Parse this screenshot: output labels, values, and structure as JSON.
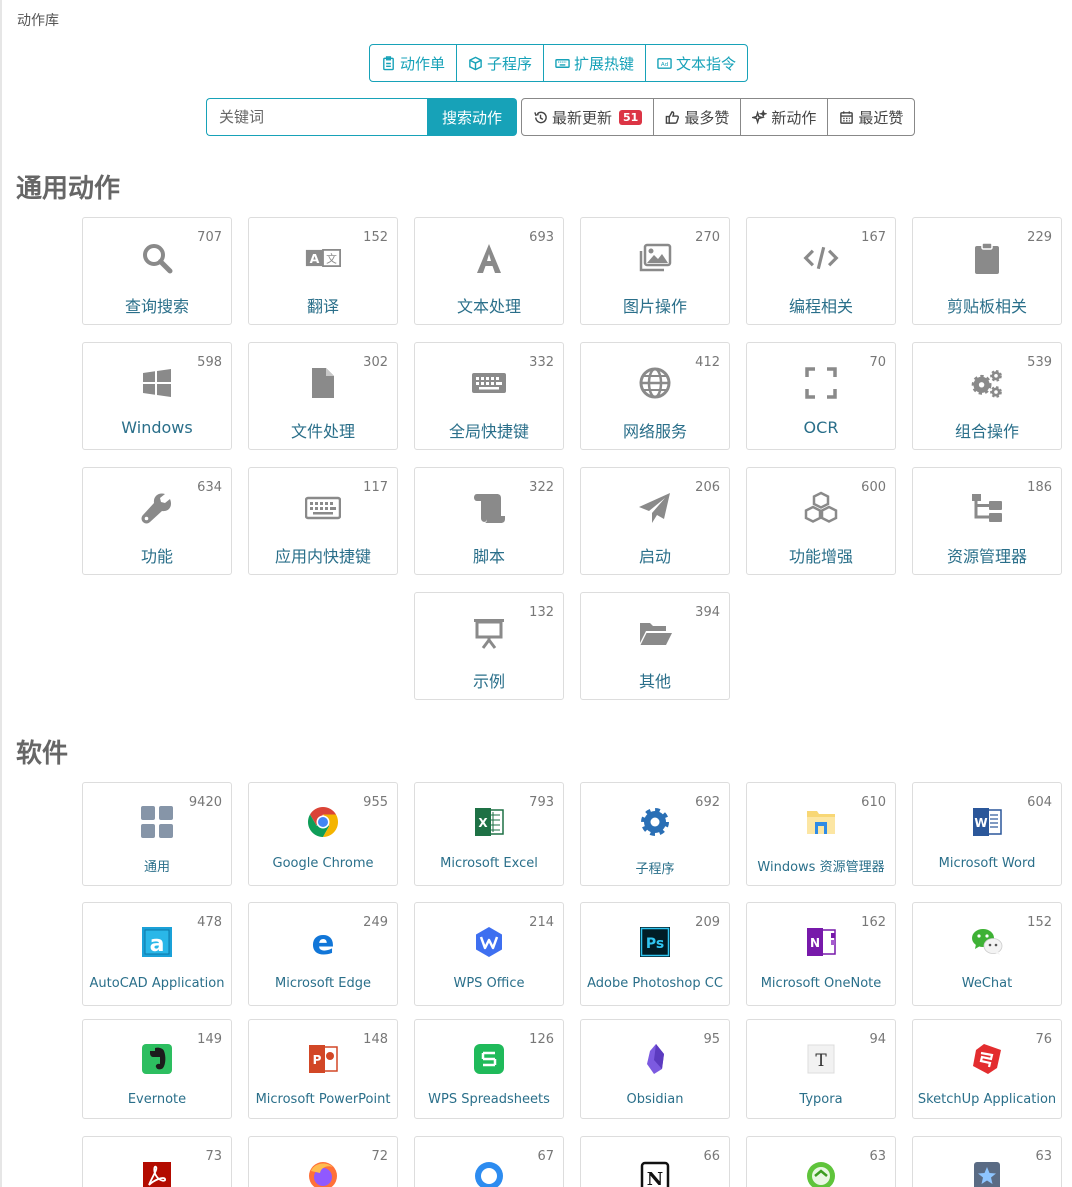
{
  "breadcrumb": "动作库",
  "type_tabs": [
    {
      "label": "动作单",
      "icon": "clipboard-icon"
    },
    {
      "label": "子程序",
      "icon": "cube-icon"
    },
    {
      "label": "扩展热键",
      "icon": "keyboard-icon"
    },
    {
      "label": "文本指令",
      "icon": "ad-icon"
    }
  ],
  "search": {
    "placeholder": "关键词",
    "button": "搜索动作"
  },
  "sort_tabs": [
    {
      "label": "最新更新",
      "icon": "history-icon",
      "badge": "51"
    },
    {
      "label": "最多赞",
      "icon": "thumbs-up-icon"
    },
    {
      "label": "新动作",
      "icon": "sparkle-icon"
    },
    {
      "label": "最近赞",
      "icon": "calendar-icon"
    }
  ],
  "colors": {
    "accent": "#17a2b8",
    "icon_gray": "#8a8a8a",
    "label_blue": "#2a6f8a",
    "badge_red": "#dc3545"
  },
  "sections": {
    "general": {
      "title": "通用动作",
      "cards": [
        {
          "label": "查询搜索",
          "count": "707",
          "icon": "search-icon"
        },
        {
          "label": "翻译",
          "count": "152",
          "icon": "translate-icon"
        },
        {
          "label": "文本处理",
          "count": "693",
          "icon": "font-a-icon"
        },
        {
          "label": "图片操作",
          "count": "270",
          "icon": "images-icon"
        },
        {
          "label": "编程相关",
          "count": "167",
          "icon": "code-icon"
        },
        {
          "label": "剪贴板相关",
          "count": "229",
          "icon": "clipboard-icon"
        },
        {
          "label": "Windows",
          "count": "598",
          "icon": "windows-icon"
        },
        {
          "label": "文件处理",
          "count": "302",
          "icon": "file-icon"
        },
        {
          "label": "全局快捷键",
          "count": "332",
          "icon": "keyboard-icon"
        },
        {
          "label": "网络服务",
          "count": "412",
          "icon": "globe-icon"
        },
        {
          "label": "OCR",
          "count": "70",
          "icon": "expand-icon"
        },
        {
          "label": "组合操作",
          "count": "539",
          "icon": "cogs-icon"
        },
        {
          "label": "功能",
          "count": "634",
          "icon": "wrench-icon"
        },
        {
          "label": "应用内快捷键",
          "count": "117",
          "icon": "keyboard-icon"
        },
        {
          "label": "脚本",
          "count": "322",
          "icon": "scroll-icon"
        },
        {
          "label": "启动",
          "count": "206",
          "icon": "paper-plane-icon"
        },
        {
          "label": "功能增强",
          "count": "600",
          "icon": "cubes-icon"
        },
        {
          "label": "资源管理器",
          "count": "186",
          "icon": "sitemap-icon"
        },
        {
          "label": "示例",
          "count": "132",
          "icon": "presentation-icon"
        },
        {
          "label": "其他",
          "count": "394",
          "icon": "folder-open-icon"
        }
      ]
    },
    "software": {
      "title": "软件",
      "cards": [
        {
          "label": "通用",
          "count": "9420",
          "icon": "grid-icon"
        },
        {
          "label": "Google Chrome",
          "count": "955",
          "icon": "chrome-icon"
        },
        {
          "label": "Microsoft Excel",
          "count": "793",
          "icon": "excel-icon"
        },
        {
          "label": "子程序",
          "count": "692",
          "icon": "gear-icon"
        },
        {
          "label": "Windows 资源管理器",
          "count": "610",
          "icon": "explorer-icon"
        },
        {
          "label": "Microsoft Word",
          "count": "604",
          "icon": "word-icon"
        },
        {
          "label": "AutoCAD Application",
          "count": "478",
          "icon": "autocad-icon"
        },
        {
          "label": "Microsoft Edge",
          "count": "249",
          "icon": "edge-icon"
        },
        {
          "label": "WPS Office",
          "count": "214",
          "icon": "wps-icon"
        },
        {
          "label": "Adobe Photoshop CC",
          "count": "209",
          "icon": "photoshop-icon"
        },
        {
          "label": "Microsoft OneNote",
          "count": "162",
          "icon": "onenote-icon"
        },
        {
          "label": "WeChat",
          "count": "152",
          "icon": "wechat-icon"
        },
        {
          "label": "Evernote",
          "count": "149",
          "icon": "evernote-icon"
        },
        {
          "label": "Microsoft PowerPoint",
          "count": "148",
          "icon": "powerpoint-icon"
        },
        {
          "label": "WPS Spreadsheets",
          "count": "126",
          "icon": "wps-spreadsheets-icon"
        },
        {
          "label": "Obsidian",
          "count": "95",
          "icon": "obsidian-icon"
        },
        {
          "label": "Typora",
          "count": "94",
          "icon": "typora-icon"
        },
        {
          "label": "SketchUp Application",
          "count": "76",
          "icon": "sketchup-icon"
        },
        {
          "label": "",
          "count": "73",
          "icon": "acrobat-icon"
        },
        {
          "label": "",
          "count": "72",
          "icon": "firefox-icon"
        },
        {
          "label": "",
          "count": "67",
          "icon": "blue-circle-app-icon"
        },
        {
          "label": "",
          "count": "66",
          "icon": "notion-icon"
        },
        {
          "label": "",
          "count": "63",
          "icon": "green-circle-app-icon"
        },
        {
          "label": "",
          "count": "63",
          "icon": "star-app-icon"
        }
      ]
    }
  }
}
